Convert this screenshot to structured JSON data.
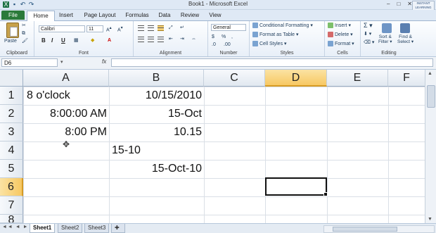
{
  "window": {
    "title": "Book1 - Microsoft Excel",
    "controls": [
      "–",
      "□",
      "✕"
    ]
  },
  "badge": {
    "line1": "INSTANT",
    "line2": "LEARNING",
    "line3": "CENTER"
  },
  "ribbon_tabs": [
    "File",
    "Home",
    "Insert",
    "Page Layout",
    "Formulas",
    "Data",
    "Review",
    "View"
  ],
  "ribbon": {
    "clipboard": {
      "label": "Clipboard",
      "paste": "Paste"
    },
    "font": {
      "label": "Font",
      "name": "Calibri",
      "size": "11",
      "bold": "B",
      "italic": "I",
      "underline": "U"
    },
    "alignment": {
      "label": "Alignment"
    },
    "number": {
      "label": "Number",
      "format": "General",
      "currency": "$",
      "percent": "%",
      "comma": ","
    },
    "styles": {
      "label": "Styles",
      "conditional": "Conditional Formatting",
      "table": "Format as Table",
      "cell": "Cell Styles"
    },
    "cells": {
      "label": "Cells",
      "insert": "Insert",
      "delete": "Delete",
      "format": "Format"
    },
    "editing": {
      "label": "Editing",
      "sort": "Sort &",
      "sort2": "Filter",
      "find": "Find &",
      "find2": "Select"
    }
  },
  "formula_bar": {
    "name_box": "D6",
    "fx": "fx",
    "value": ""
  },
  "columns": [
    "A",
    "B",
    "C",
    "D",
    "E",
    "F"
  ],
  "rows": [
    "1",
    "2",
    "3",
    "4",
    "5",
    "6",
    "7",
    "8"
  ],
  "cells": {
    "A1": "8 o'clock",
    "A2": "8:00:00 AM",
    "A3": "8:00 PM",
    "B1": "10/15/2010",
    "B2": "15-Oct",
    "B3": "10.15",
    "B4": "15-10",
    "B5": "15-Oct-10"
  },
  "selection": {
    "active_column": "D",
    "active_row": "6"
  },
  "sheets": [
    "Sheet1",
    "Sheet2",
    "Sheet3"
  ],
  "active_sheet": "Sheet1"
}
